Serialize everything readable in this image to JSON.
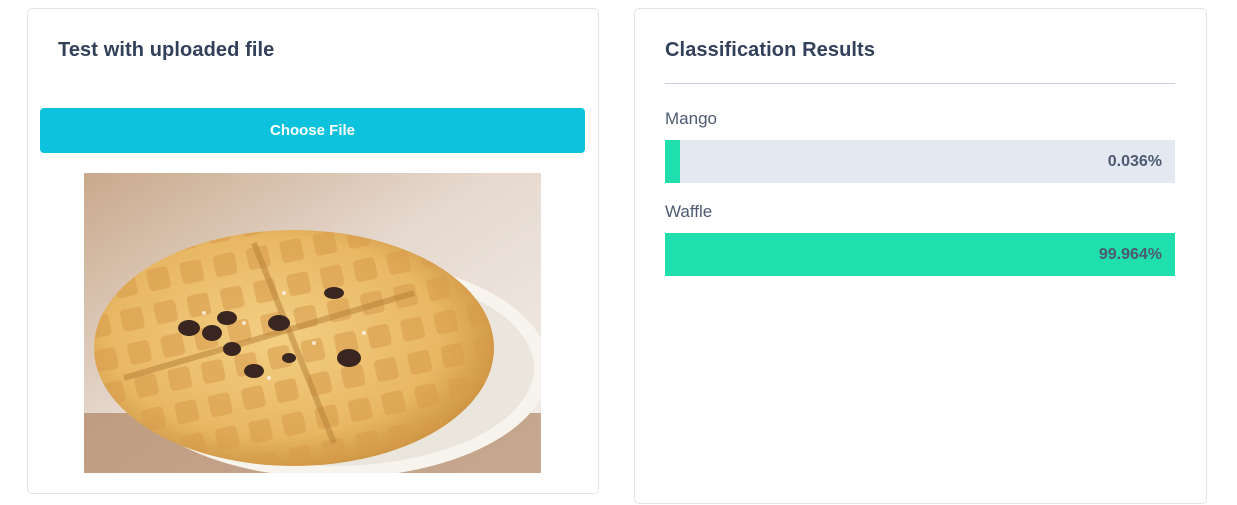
{
  "upload_panel": {
    "title": "Test with uploaded file",
    "choose_button_label": "Choose File",
    "image_subject": "waffle-with-chocolate-chips-photo"
  },
  "results_panel": {
    "title": "Classification Results",
    "results": [
      {
        "label": "Mango",
        "value_text": "0.036%",
        "fill_fraction": 0.00036
      },
      {
        "label": "Waffle",
        "value_text": "99.964%",
        "fill_fraction": 0.99964
      }
    ]
  },
  "colors": {
    "accent_button": "#0cc2dd",
    "bar_fill": "#1fdfac",
    "bar_track": "#e4e8f1",
    "title_text": "#32405a"
  }
}
